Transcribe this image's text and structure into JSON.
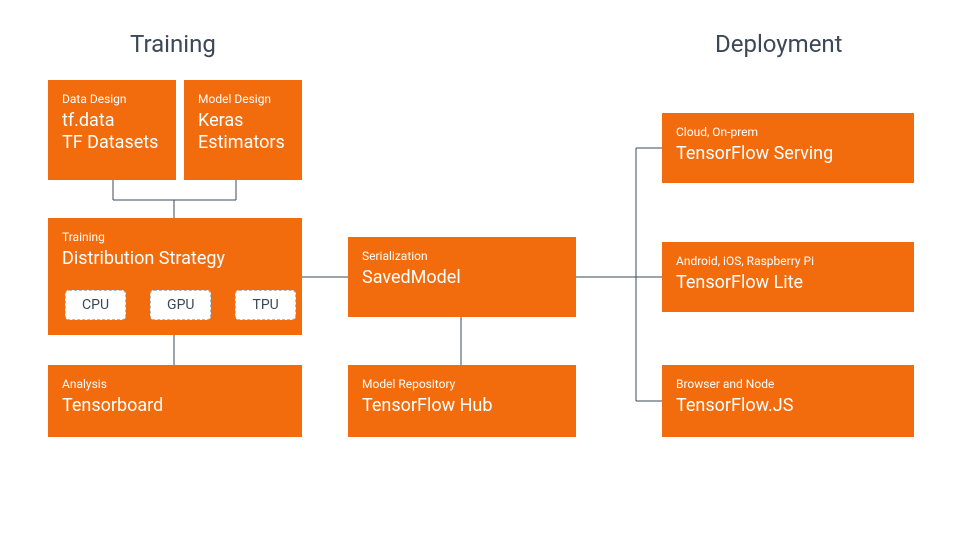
{
  "sections": {
    "training": "Training",
    "deployment": "Deployment"
  },
  "boxes": {
    "data_design": {
      "small": "Data Design",
      "big": "tf.data\nTF Datasets"
    },
    "model_design": {
      "small": "Model Design",
      "big": "Keras\nEstimators"
    },
    "training": {
      "small": "Training",
      "big": "Distribution Strategy"
    },
    "analysis": {
      "small": "Analysis",
      "big": "Tensorboard"
    },
    "serialization": {
      "small": "Serialization",
      "big": "SavedModel"
    },
    "model_repo": {
      "small": "Model Repository",
      "big": "TensorFlow Hub"
    },
    "serving": {
      "small": "Cloud, On-prem",
      "big": "TensorFlow Serving"
    },
    "lite": {
      "small": "Android, iOS, Raspberry Pi",
      "big": "TensorFlow Lite"
    },
    "js": {
      "small": "Browser and Node",
      "big": "TensorFlow.JS"
    }
  },
  "chips": {
    "cpu": "CPU",
    "gpu": "GPU",
    "tpu": "TPU"
  },
  "colors": {
    "orange": "#f26c0d",
    "text_dark": "#3c4858"
  }
}
